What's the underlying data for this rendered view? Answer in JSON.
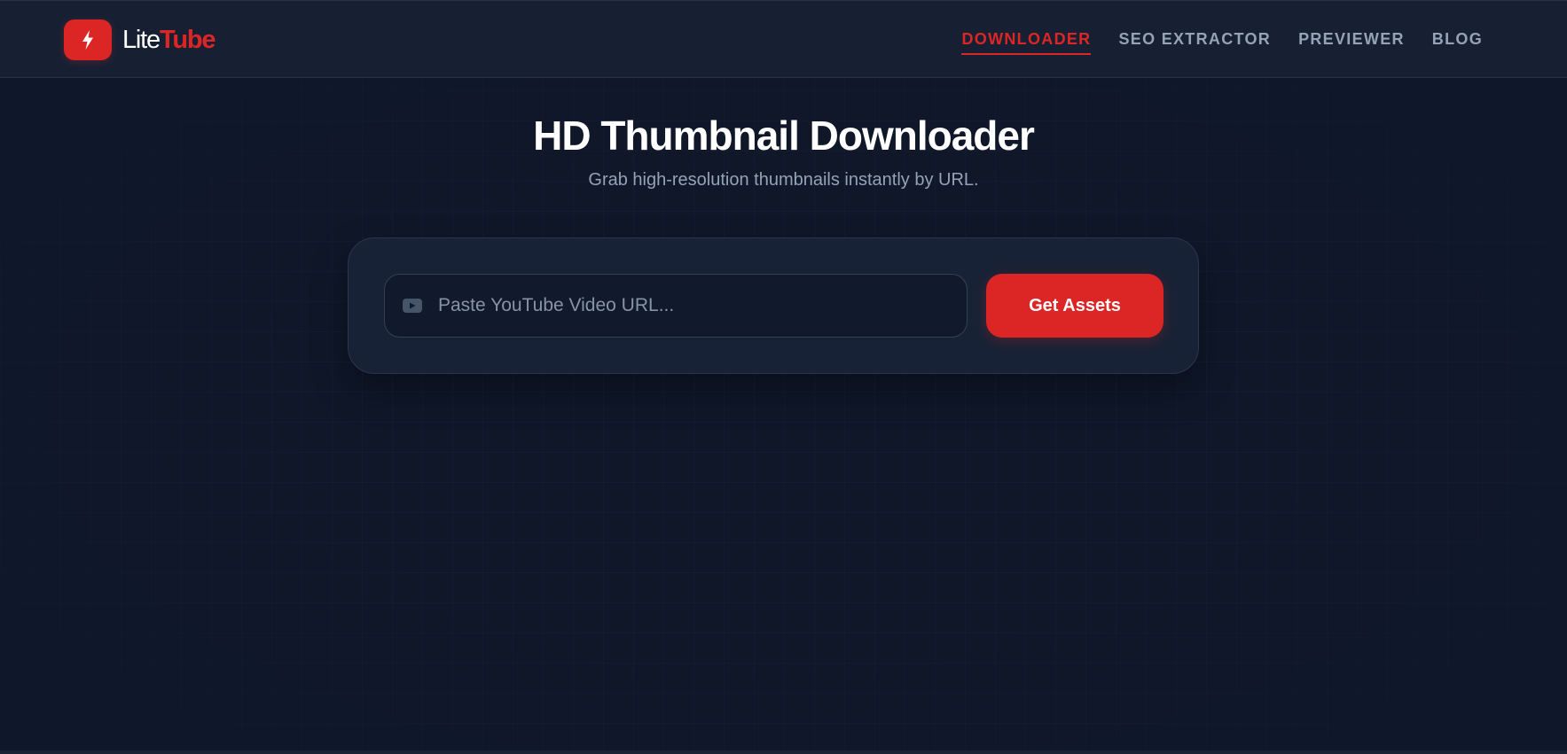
{
  "brand": {
    "name_part1": "Lite",
    "name_part2": "Tube",
    "icon": "lightning-bolt-icon",
    "accent_color": "#dc2626"
  },
  "nav": {
    "items": [
      {
        "label": "DOWNLOADER",
        "active": true
      },
      {
        "label": "SEO EXTRACTOR",
        "active": false
      },
      {
        "label": "PREVIEWER",
        "active": false
      },
      {
        "label": "BLOG",
        "active": false
      }
    ]
  },
  "hero": {
    "title": "HD Thumbnail Downloader",
    "subtitle": "Grab high-resolution thumbnails instantly by URL."
  },
  "search": {
    "icon": "youtube-play-icon",
    "value": "",
    "placeholder": "Paste YouTube Video URL...",
    "button_label": "Get Assets"
  },
  "colors": {
    "background": "#0f172a",
    "header": "#172033",
    "card": "#182236",
    "muted_text": "#94a3b8"
  }
}
